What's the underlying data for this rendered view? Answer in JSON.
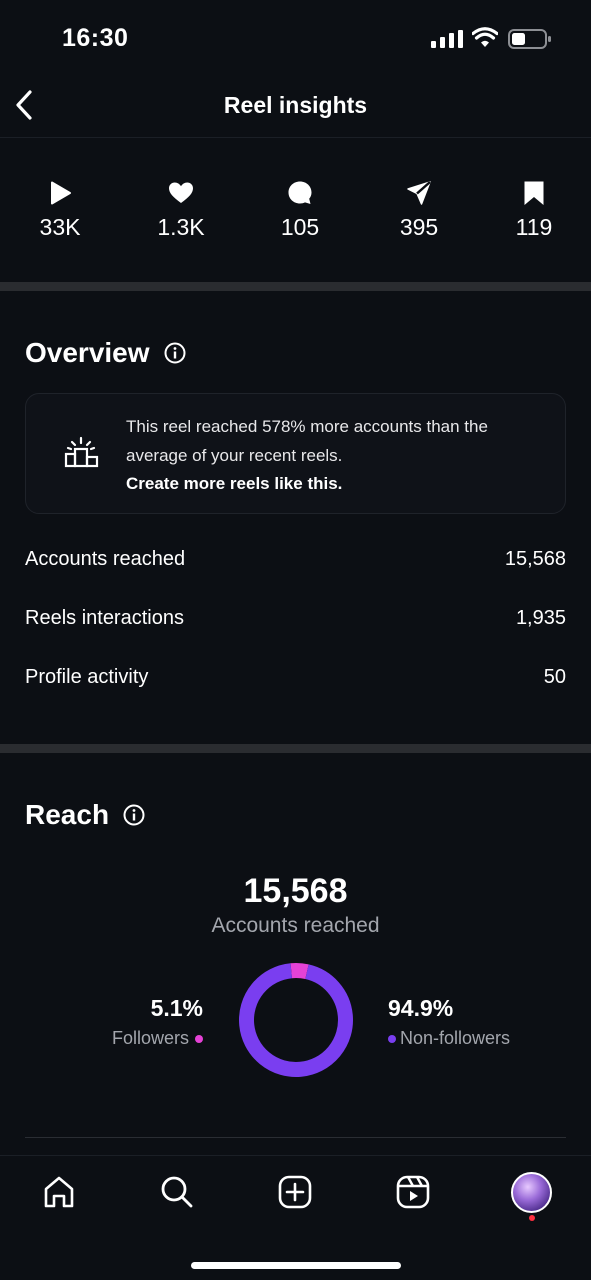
{
  "status_bar": {
    "time": "16:30"
  },
  "header": {
    "title": "Reel insights"
  },
  "stats": [
    {
      "icon": "play-icon",
      "value": "33K"
    },
    {
      "icon": "heart-icon",
      "value": "1.3K"
    },
    {
      "icon": "comment-icon",
      "value": "105"
    },
    {
      "icon": "share-icon",
      "value": "395"
    },
    {
      "icon": "bookmark-icon",
      "value": "119"
    }
  ],
  "overview": {
    "title": "Overview",
    "banner": {
      "text": "This reel reached 578% more accounts than the average of your recent reels.",
      "cta": "Create more reels like this."
    },
    "metrics": [
      {
        "label": "Accounts reached",
        "value": "15,568"
      },
      {
        "label": "Reels interactions",
        "value": "1,935"
      },
      {
        "label": "Profile activity",
        "value": "50"
      }
    ]
  },
  "reach": {
    "title": "Reach",
    "total": "15,568",
    "subtitle": "Accounts reached",
    "followers": {
      "percent": "5.1%",
      "label": "Followers",
      "fraction": 0.051,
      "color": "#e542d6"
    },
    "non_followers": {
      "percent": "94.9%",
      "label": "Non-followers",
      "fraction": 0.949,
      "color": "#7a3ef0"
    }
  },
  "tab_bar": {
    "tabs": [
      "home-icon",
      "search-icon",
      "create-icon",
      "reels-icon",
      "profile-avatar"
    ]
  }
}
